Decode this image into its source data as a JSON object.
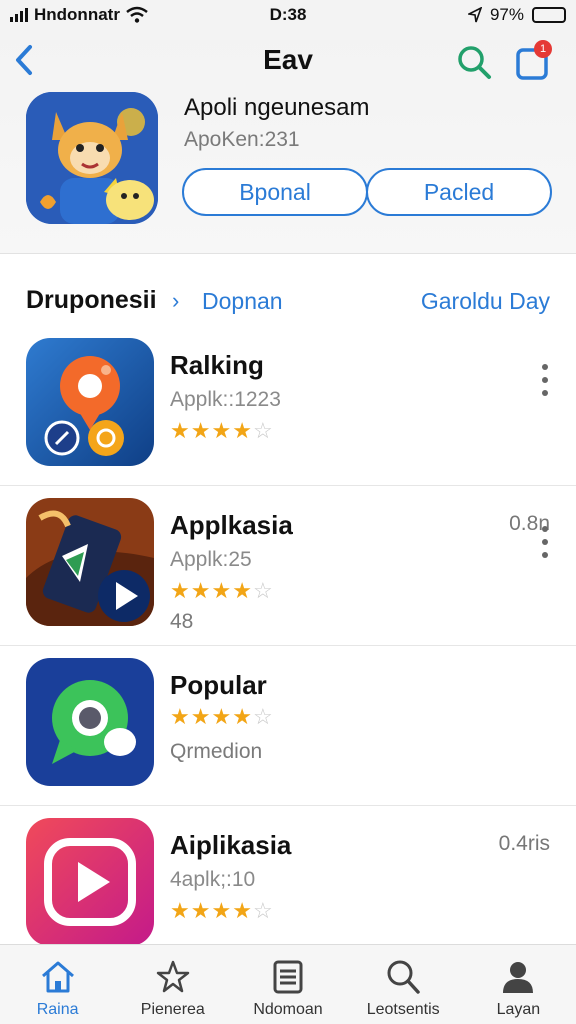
{
  "status": {
    "carrier": "Hndonnatr",
    "time": "D:38",
    "battery": "97%",
    "battery_level": 0.97
  },
  "header": {
    "title": "Eav"
  },
  "notifications": {
    "badge": "1"
  },
  "app": {
    "name": "Apoli ngeunesam",
    "subtitle": "ApoKen:231",
    "primary_button": "Bponal",
    "secondary_button": "Pacled"
  },
  "section": {
    "title": "Druponesii",
    "chevron": "›",
    "link": "Dopnan",
    "right_link": "Garoldu Day"
  },
  "list": [
    {
      "title": "Ralking",
      "subtitle": "Applk::1223",
      "rating": 4,
      "max_rating": 5,
      "extra": "",
      "size": "",
      "has_menu": true
    },
    {
      "title": "Applkasia",
      "subtitle": "Applk:25",
      "rating": 4,
      "max_rating": 5,
      "extra": "48",
      "size": "0.8n",
      "has_menu": true
    },
    {
      "title": "Popular",
      "subtitle": "",
      "rating": 4,
      "max_rating": 5,
      "extra": "Qrmedion",
      "size": "",
      "has_menu": false
    },
    {
      "title": "Aiplikasia",
      "subtitle": "4aplk;:10",
      "rating": 4,
      "max_rating": 5,
      "extra": "",
      "size": "0.4ris",
      "has_menu": false
    }
  ],
  "tabs": [
    {
      "label": "Raina",
      "icon": "home-icon",
      "active": true
    },
    {
      "label": "Pienerea",
      "icon": "star-icon",
      "active": false
    },
    {
      "label": "Ndomoan",
      "icon": "apps-icon",
      "active": false
    },
    {
      "label": "Leotsentis",
      "icon": "search-icon",
      "active": false
    },
    {
      "label": "Layan",
      "icon": "person-icon",
      "active": false
    }
  ],
  "colors": {
    "accent": "#2b7bd6",
    "star": "#f2a516",
    "badge": "#e53935",
    "search_icon": "#22a06b"
  }
}
